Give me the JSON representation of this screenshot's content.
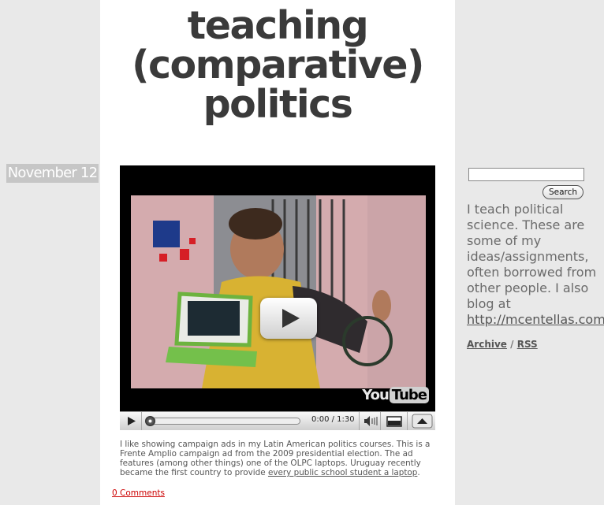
{
  "header": {
    "title": "teaching (comparative) politics"
  },
  "post": {
    "date": "November 12",
    "video": {
      "time": "0:00 / 1:30",
      "logo_you": "You",
      "logo_tube": "Tube",
      "progress": 0
    },
    "body_text": "I like showing campaign ads in my Latin American politics courses. This is a Frente Amplio campaign ad from the 2009 presidential election. The ad features (among other things) one of the OLPC laptops. Uruguay recently became the first country to provide ",
    "body_link": "every public school student a laptop",
    "body_end": ".",
    "comments_label": "0 Comments"
  },
  "sidebar": {
    "search_button": "Search",
    "about_text": "I teach political science. These are some of my ideas/assignments, often borrowed from other people. I also blog at",
    "about_link": "http://mcentellas.com",
    "archive_label": "Archive",
    "separator": "/",
    "rss_label": "RSS"
  },
  "colors": {
    "background": "#e9e9e9",
    "content_background": "#ffffff",
    "title_text": "#3a3a3a",
    "date_background": "#c6c6c6",
    "comments_link": "#cc0000"
  }
}
